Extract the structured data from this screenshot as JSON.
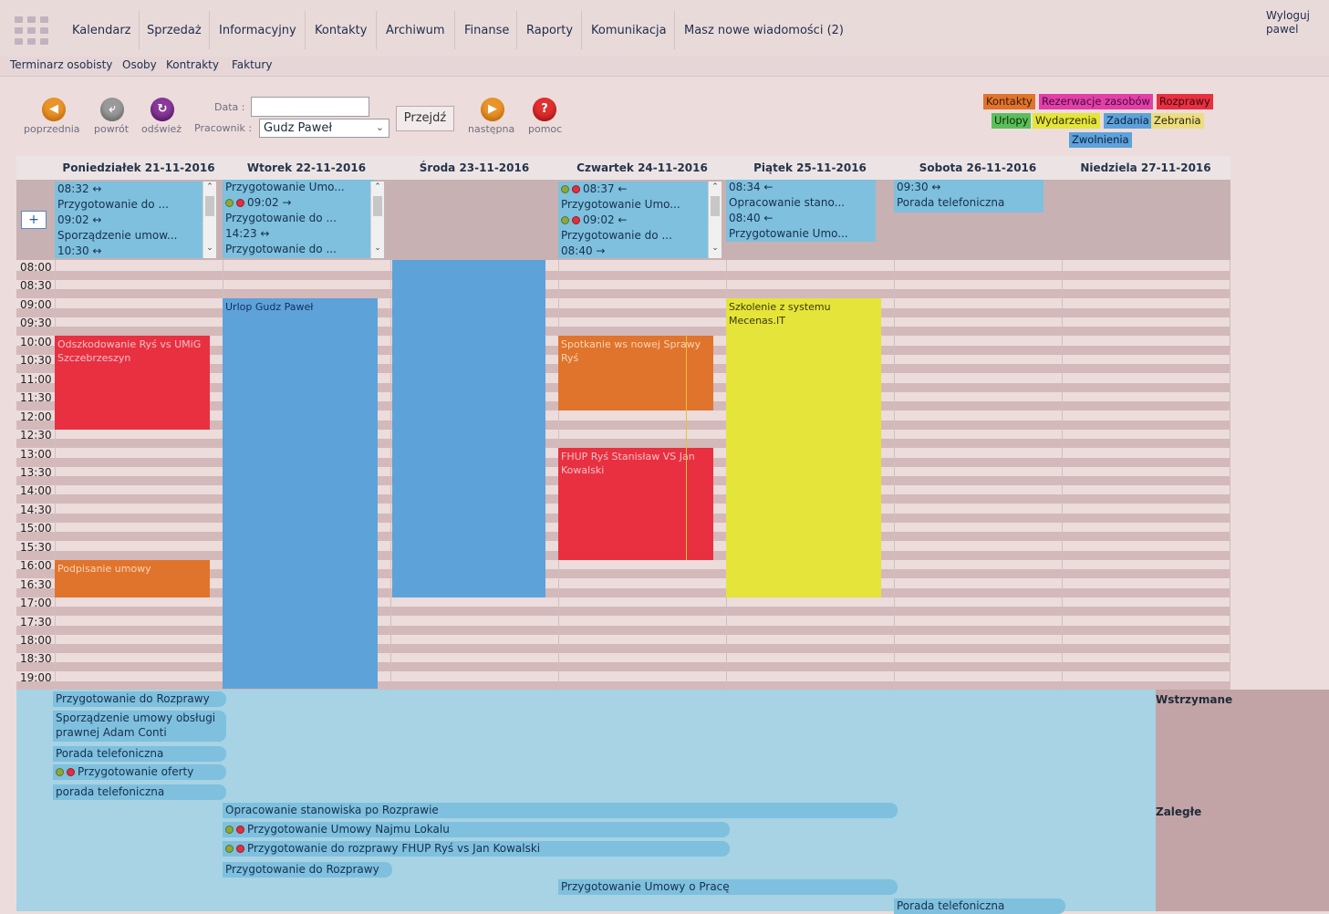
{
  "menu": {
    "items": [
      "Kalendarz",
      "Sprzedaż",
      "Informacyjny",
      "Kontakty",
      "Archiwum",
      "Finanse",
      "Raporty",
      "Komunikacja",
      "Masz nowe wiadomości (2)"
    ],
    "logout": "Wyloguj",
    "user": "pawel"
  },
  "subnav": [
    "Terminarz osobisty",
    "Osoby",
    "Kontrakty",
    "Faktury"
  ],
  "toolbar": {
    "prev": "poprzednia",
    "back": "powrót",
    "refresh": "odśwież",
    "next": "następna",
    "help": "pomoc",
    "date_label": "Data :",
    "date_value": "",
    "employee_label": "Pracownik :",
    "employee_value": "Gudz Paweł",
    "go": "Przejdź"
  },
  "legend": [
    {
      "label": "Kontakty",
      "color": "#e0742c"
    },
    {
      "label": "Rezerwacje zasobów",
      "color": "#e040a8"
    },
    {
      "label": "Rozprawy",
      "color": "#e83040"
    },
    {
      "label": "Urlopy",
      "color": "#5cbe5a"
    },
    {
      "label": "Wydarzenia",
      "color": "#e4e43a"
    },
    {
      "label": "Zadania",
      "color": "#5ea2da"
    },
    {
      "label": "Zebrania",
      "color": "#ecdd82"
    },
    {
      "label": "Zwolnienia",
      "color": "#5ea2da"
    }
  ],
  "days": [
    "Poniedziałek 21-11-2016",
    "Wtorek 22-11-2016",
    "Środa 23-11-2016",
    "Czwartek 24-11-2016",
    "Piątek 25-11-2016",
    "Sobota 26-11-2016",
    "Niedziela 27-11-2016"
  ],
  "allday": {
    "mon": [
      "08:32 ↔",
      "Przygotowanie do ...",
      "09:02 ↔",
      "Sporządzenie umow...",
      "10:30 ↔"
    ],
    "tue": [
      "Przygotowanie Umo...",
      "09:02 →",
      "Przygotowanie do ...",
      "14:23 ↔",
      "Przygotowanie do ..."
    ],
    "thu": [
      "08:37 ←",
      "Przygotowanie Umo...",
      "09:02 ←",
      "Przygotowanie do ...",
      "08:40 →"
    ],
    "fri": [
      "08:34 ←",
      "Opracowanie stano...",
      "08:40 ←",
      "Przygotowanie Umo..."
    ],
    "sat": [
      "09:30 ↔",
      "Porada telefoniczna"
    ]
  },
  "times": [
    "08:00",
    "08:30",
    "09:00",
    "09:30",
    "10:00",
    "10:30",
    "11:00",
    "11:30",
    "12:00",
    "12:30",
    "13:00",
    "13:30",
    "14:00",
    "14:30",
    "15:00",
    "15:30",
    "16:00",
    "16:30",
    "17:00",
    "17:30",
    "18:00",
    "18:30",
    "19:00"
  ],
  "events": {
    "mon1": "Odszkodowanie Ryś vs UMiG Szczebrzeszyn",
    "mon2": "Podpisanie umowy",
    "tue1": "Urlop Gudz Paweł",
    "thu1": "Spotkanie ws nowej Sprawy Ryś",
    "thu2": "FHUP Ryś Stanisław VS Jan Kowalski",
    "fri1": "Szkolenie z systemu Mecenas.IT"
  },
  "tasks": [
    "Przygotowanie do Rozprawy",
    "Sporządzenie umowy obsługi prawnej Adam Conti",
    "Porada telefoniczna",
    "Przygotowanie oferty",
    "porada telefoniczna",
    "Opracowanie stanowiska po Rozprawie",
    "Przygotowanie Umowy Najmu Lokalu",
    "Przygotowanie do rozprawy FHUP Ryś vs Jan Kowalski",
    "Przygotowanie do Rozprawy",
    "Przygotowanie Umowy o Pracę",
    "Porada telefoniczna"
  ],
  "status": {
    "suspended": "Wstrzymane",
    "overdue": "Zaległe"
  },
  "colors": {
    "orange": "#e0742c",
    "red": "#e83040",
    "blue": "#5ea2da",
    "yellow": "#e4e43a"
  }
}
